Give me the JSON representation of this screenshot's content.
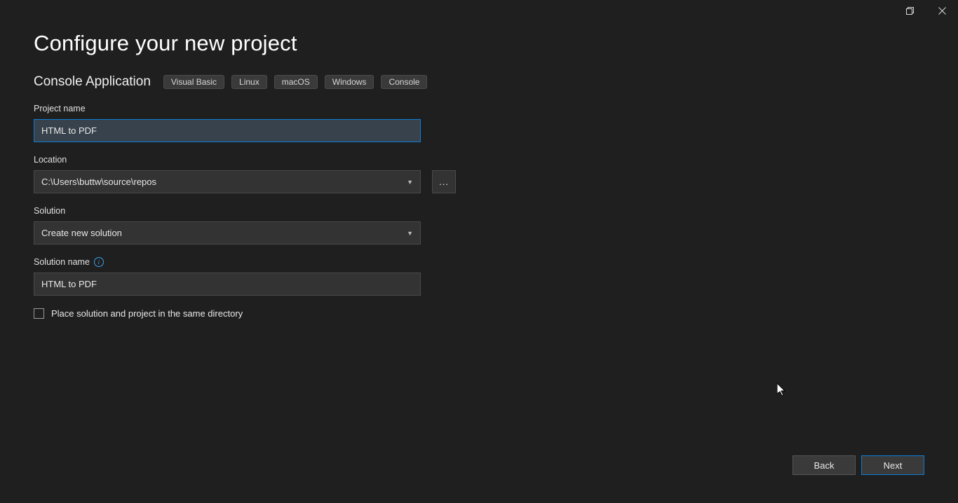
{
  "header": {
    "title": "Configure your new project",
    "template_name": "Console Application",
    "tags": [
      "Visual Basic",
      "Linux",
      "macOS",
      "Windows",
      "Console"
    ]
  },
  "fields": {
    "project_name": {
      "label": "Project name",
      "value": "HTML to PDF"
    },
    "location": {
      "label": "Location",
      "value": "C:\\Users\\buttw\\source\\repos",
      "browse": "..."
    },
    "solution": {
      "label": "Solution",
      "value": "Create new solution"
    },
    "solution_name": {
      "label": "Solution name",
      "value": "HTML to PDF"
    },
    "same_dir": {
      "label": "Place solution and project in the same directory",
      "checked": false
    }
  },
  "footer": {
    "back": "Back",
    "next": "Next"
  }
}
